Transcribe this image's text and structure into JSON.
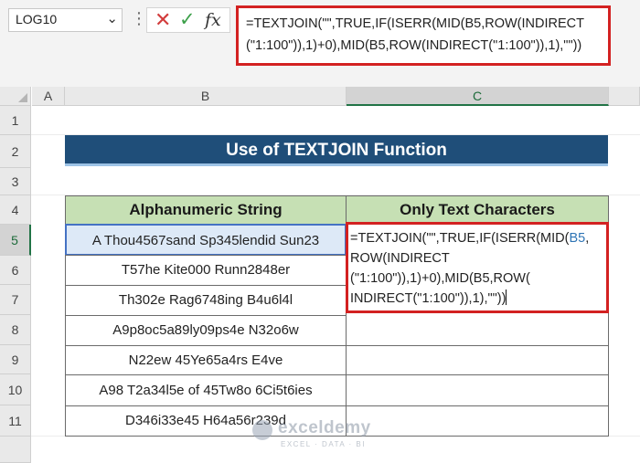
{
  "name_box": {
    "value": "LOG10"
  },
  "formula_bar": {
    "cancel_glyph": "✕",
    "enter_glyph": "✓",
    "fx_label": "fx",
    "line1": "=TEXTJOIN(\"\",TRUE,IF(ISERR(MID(B5,ROW(INDIRECT",
    "line2": "(\"1:100\")),1)+0),MID(B5,ROW(INDIRECT(\"1:100\")),1),\"\"))"
  },
  "columns": [
    "A",
    "B",
    "C"
  ],
  "rows": [
    "1",
    "2",
    "3",
    "4",
    "5",
    "6",
    "7",
    "8",
    "9",
    "10",
    "11"
  ],
  "title": "Use of TEXTJOIN Function",
  "table": {
    "headers": [
      "Alphanumeric String",
      "Only Text Characters"
    ],
    "strings": [
      "A Thou4567sand Sp345lendid Sun23",
      "T57he Kite000 Runn2848er",
      "Th302e Rag6748ing B4u6l4l",
      "A9p8oc5a89ly09ps4e N32o6w",
      "N22ew 45Ye65a4rs E4ve",
      "A98 T2a34l5e of 45Tw8o 6Ci5t6ies",
      "D346i33e45 H64a56r239d"
    ]
  },
  "cell_edit": {
    "seg1": "=TEXTJOIN(\"\",TRUE,IF(ISERR(MID(",
    "ref1": "B5",
    "seg2": ",",
    "seg3": "ROW(INDIRECT",
    "seg4": "(\"1:100\")),1)+0),MID(B5,ROW(",
    "seg5": "INDIRECT(\"1:100\")),1),\"\"))"
  },
  "watermark": {
    "name": "exceldemy",
    "tagline": "EXCEL · DATA · BI"
  }
}
